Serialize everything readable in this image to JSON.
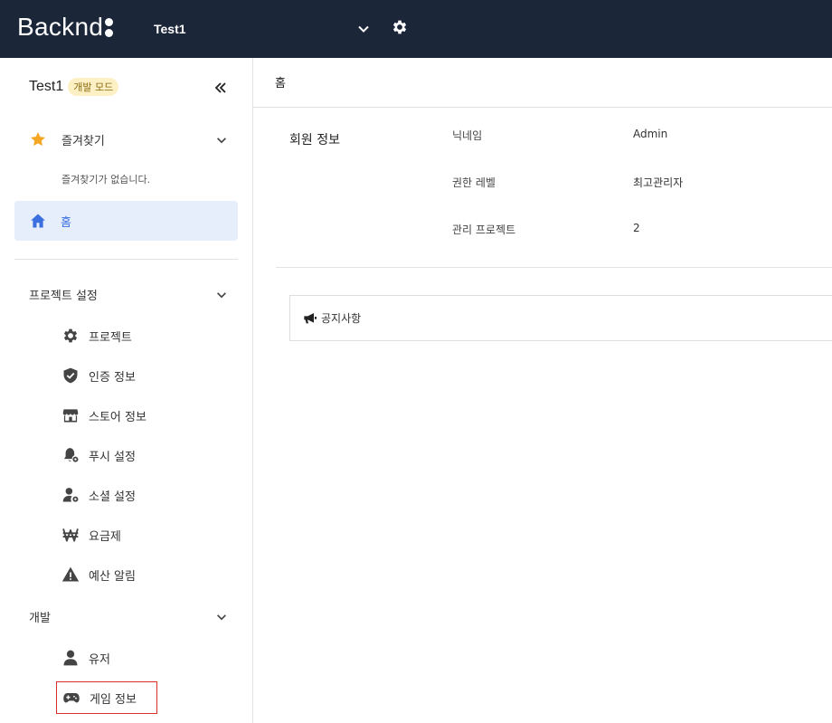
{
  "topbar": {
    "logo_text": "Backnd",
    "project_name": "Test1",
    "icons": {
      "selector": "chevron-down-icon",
      "settings": "gear-icon"
    }
  },
  "sidebar": {
    "title": "Test1",
    "badge": "개발 모드",
    "favorites": {
      "label": "즐겨찾기",
      "empty_text": "즐겨찾기가 없습니다."
    },
    "home": {
      "label": "홈"
    },
    "project_settings": {
      "label": "프로젝트 설정",
      "items": [
        {
          "label": "프로젝트",
          "icon": "gear-icon"
        },
        {
          "label": "인증 정보",
          "icon": "shield-check-icon"
        },
        {
          "label": "스토어 정보",
          "icon": "store-icon"
        },
        {
          "label": "푸시 설정",
          "icon": "bell-gear-icon"
        },
        {
          "label": "소셜 설정",
          "icon": "user-gear-icon"
        },
        {
          "label": "요금제",
          "icon": "won-icon"
        },
        {
          "label": "예산 알림",
          "icon": "warning-icon"
        }
      ]
    },
    "development": {
      "label": "개발",
      "items": [
        {
          "label": "유저",
          "icon": "user-icon"
        },
        {
          "label": "게임 정보",
          "icon": "gamepad-icon"
        }
      ]
    }
  },
  "main": {
    "title": "홈",
    "member_info": {
      "title": "회원 정보",
      "rows": [
        {
          "label": "닉네임",
          "value": "Admin"
        },
        {
          "label": "권한 레벨",
          "value": "최고관리자"
        },
        {
          "label": "관리 프로젝트",
          "value": "2"
        }
      ]
    },
    "notice": {
      "label": "공지사항",
      "icon": "megaphone-icon"
    }
  },
  "colors": {
    "topbar": "#1c2639",
    "accent": "#3b6fe0",
    "star": "#f5a623",
    "badge_bg": "#fdf0c4",
    "selected_border": "#d9312b"
  }
}
